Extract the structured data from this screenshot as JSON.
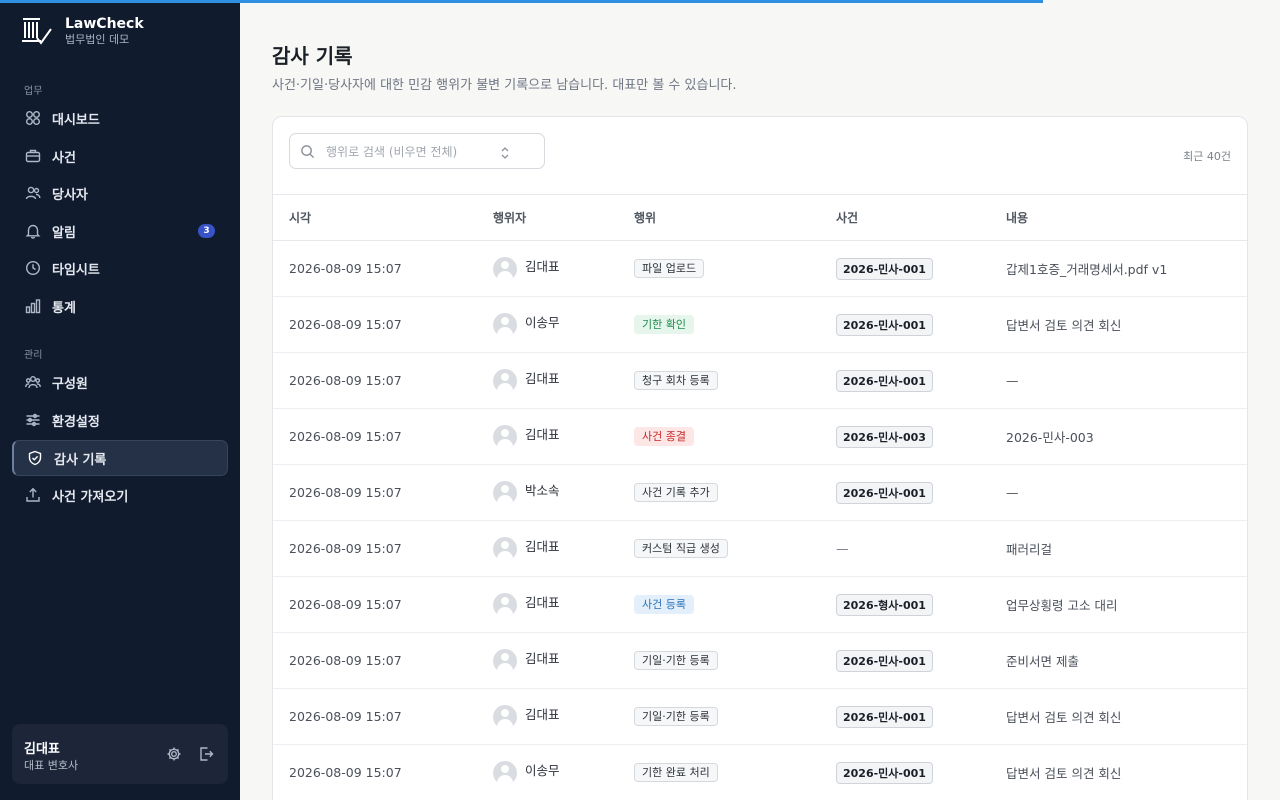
{
  "app": {
    "name": "LawCheck",
    "subtitle": "법무법인 데모"
  },
  "sidebar": {
    "section_work": "업무",
    "section_admin": "관리",
    "work_items": [
      {
        "label": "대시보드",
        "icon": "grid-icon"
      },
      {
        "label": "사건",
        "icon": "briefcase-icon"
      },
      {
        "label": "당사자",
        "icon": "users-icon"
      },
      {
        "label": "알림",
        "icon": "bell-icon",
        "badge": "3"
      },
      {
        "label": "타임시트",
        "icon": "clock-icon"
      },
      {
        "label": "통계",
        "icon": "bar-chart-icon"
      }
    ],
    "admin_items": [
      {
        "label": "구성원",
        "icon": "team-icon"
      },
      {
        "label": "환경설정",
        "icon": "sliders-icon"
      },
      {
        "label": "감사 기록",
        "icon": "shield-check-icon",
        "active": true
      },
      {
        "label": "사건 가져오기",
        "icon": "upload-icon"
      }
    ],
    "user": {
      "name": "김대표",
      "role": "대표 변호사"
    }
  },
  "page": {
    "title": "감사 기록",
    "description": "사건·기일·당사자에 대한 민감 행위가 불변 기록으로 남습니다. 대표만 볼 수 있습니다."
  },
  "filter": {
    "placeholder": "행위로 검색 (비우면 전체)",
    "count_label": "최근 40건"
  },
  "table": {
    "headers": {
      "time": "시각",
      "actor": "행위자",
      "action": "행위",
      "case": "사건",
      "content": "내용"
    },
    "rows": [
      {
        "time": "2026-08-09 15:07",
        "actor": "김대표",
        "action": "파일 업로드",
        "action_style": "neutral",
        "case": "2026-민사-001",
        "content": "갑제1호증_거래명세서.pdf v1"
      },
      {
        "time": "2026-08-09 15:07",
        "actor": "이송무",
        "action": "기한 확인",
        "action_style": "green",
        "case": "2026-민사-001",
        "content": "답변서 검토 의견 회신"
      },
      {
        "time": "2026-08-09 15:07",
        "actor": "김대표",
        "action": "청구 회차 등록",
        "action_style": "neutral",
        "case": "2026-민사-001",
        "content": "—"
      },
      {
        "time": "2026-08-09 15:07",
        "actor": "김대표",
        "action": "사건 종결",
        "action_style": "red",
        "case": "2026-민사-003",
        "content": "2026-민사-003"
      },
      {
        "time": "2026-08-09 15:07",
        "actor": "박소속",
        "action": "사건 기록 추가",
        "action_style": "neutral",
        "case": "2026-민사-001",
        "content": "—"
      },
      {
        "time": "2026-08-09 15:07",
        "actor": "김대표",
        "action": "커스텀 직급 생성",
        "action_style": "neutral",
        "case": "—",
        "content": "패러리걸"
      },
      {
        "time": "2026-08-09 15:07",
        "actor": "김대표",
        "action": "사건 등록",
        "action_style": "blue",
        "case": "2026-형사-001",
        "content": "업무상횡령 고소 대리"
      },
      {
        "time": "2026-08-09 15:07",
        "actor": "김대표",
        "action": "기일·기한 등록",
        "action_style": "neutral",
        "case": "2026-민사-001",
        "content": "준비서면 제출"
      },
      {
        "time": "2026-08-09 15:07",
        "actor": "김대표",
        "action": "기일·기한 등록",
        "action_style": "neutral",
        "case": "2026-민사-001",
        "content": "답변서 검토 의견 회신"
      },
      {
        "time": "2026-08-09 15:07",
        "actor": "이송무",
        "action": "기한 완료 처리",
        "action_style": "neutral",
        "case": "2026-민사-001",
        "content": "답변서 검토 의견 회신"
      }
    ]
  },
  "colors": {
    "sidebar_bg": "#101b2e",
    "accent": "#2f8fe0",
    "badge": "#3852c8"
  }
}
